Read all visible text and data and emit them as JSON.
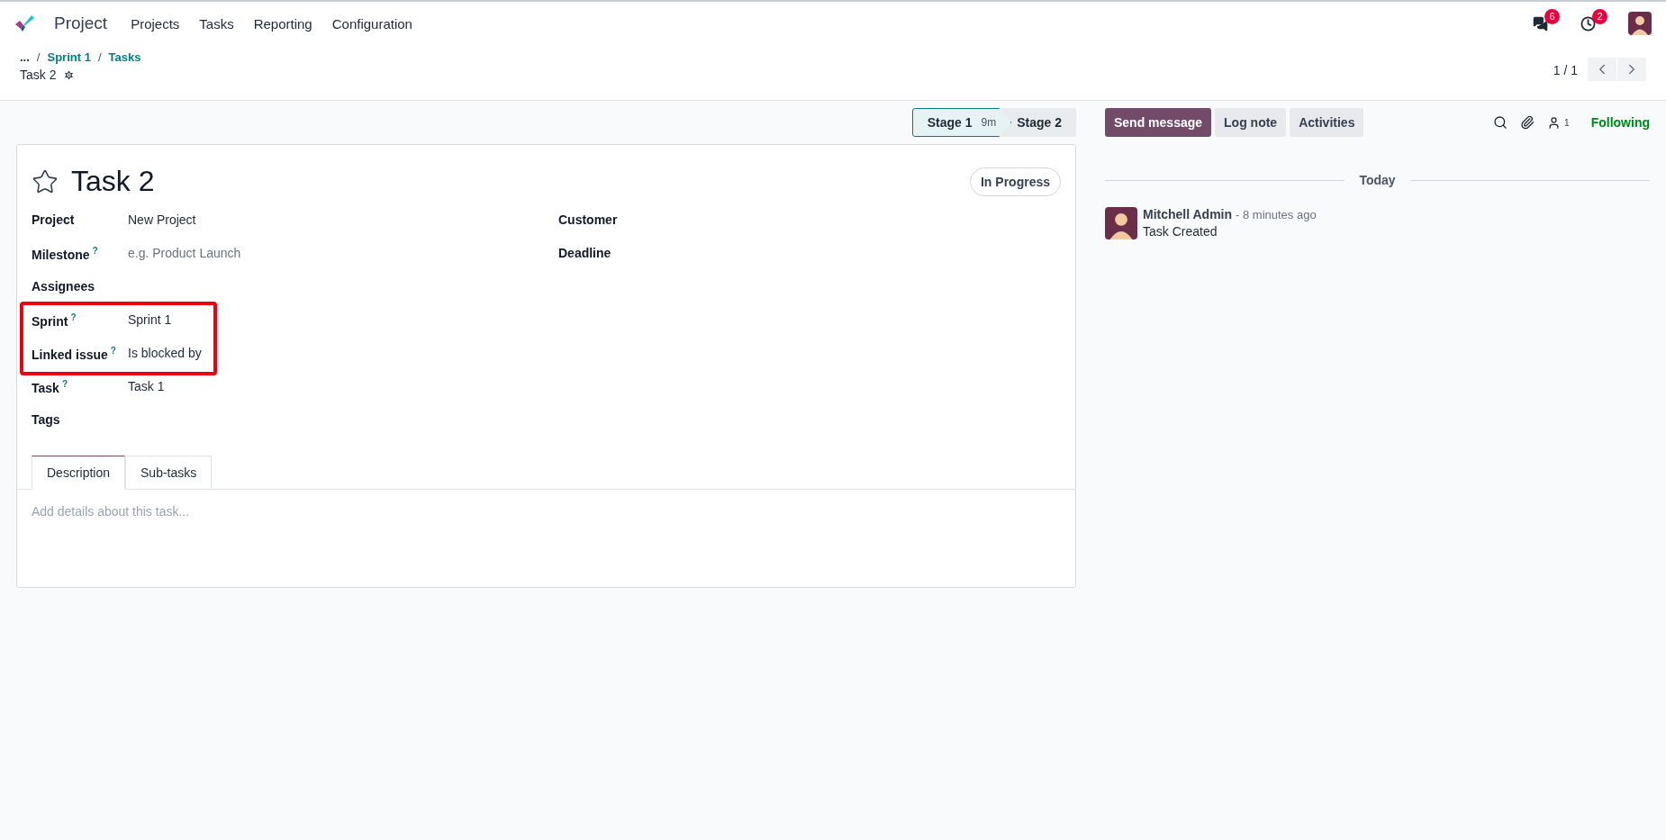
{
  "navbar": {
    "app": "Project",
    "menus": [
      "Projects",
      "Tasks",
      "Reporting",
      "Configuration"
    ],
    "messages_count": "6",
    "activities_count": "2"
  },
  "breadcrumb": {
    "ellipsis": "...",
    "items": [
      {
        "separator": "/",
        "label": "Sprint 1"
      },
      {
        "separator": "/",
        "label": "Tasks"
      }
    ],
    "current": "Task 2"
  },
  "pager": {
    "value": "1 / 1"
  },
  "stages": [
    {
      "label": "Stage 1",
      "time": "9m",
      "selected": true
    },
    {
      "label": "Stage 2",
      "selected": false
    }
  ],
  "form": {
    "title": "Task 2",
    "starred": false,
    "status": "In Progress",
    "left_fields": [
      {
        "label": "Project",
        "value": "New Project",
        "highlighted": false
      },
      {
        "label": "Milestone",
        "help": "?",
        "placeholder": "e.g. Product Launch",
        "highlighted": false
      },
      {
        "label": "Assignees",
        "highlighted": false
      },
      {
        "label": "Sprint",
        "help": "?",
        "value": "Sprint 1",
        "highlighted": true
      },
      {
        "label": "Linked issue",
        "help": "?",
        "value": "Is blocked by",
        "highlighted": true
      },
      {
        "label": "Task",
        "help": "?",
        "value": "Task 1",
        "highlighted": false
      },
      {
        "label": "Tags",
        "highlighted": false
      }
    ],
    "right_fields": [
      {
        "label": "Customer"
      },
      {
        "label": "Deadline"
      }
    ],
    "tabs": [
      {
        "label": "Description",
        "selected": true
      },
      {
        "label": "Sub-tasks",
        "selected": false
      }
    ],
    "description_placeholder": "Add details about this task..."
  },
  "chatter": {
    "buttons": [
      {
        "label": "Send message",
        "selected": true
      },
      {
        "label": "Log note",
        "selected": false
      },
      {
        "label": "Activities",
        "selected": false
      }
    ],
    "followers_count": "1",
    "follow_status": "Following",
    "date_separator": "Today",
    "messages": [
      {
        "author": "Mitchell Admin",
        "time": "- 8 minutes ago",
        "body": "Task Created"
      }
    ]
  }
}
